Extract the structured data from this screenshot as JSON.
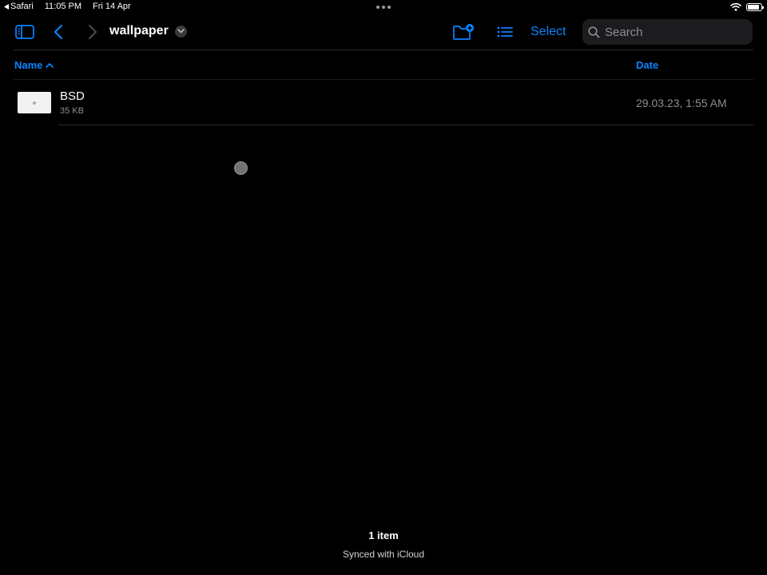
{
  "status_bar": {
    "back_app": "Safari",
    "time": "11:05 PM",
    "date": "Fri 14 Apr",
    "battery_level": 0.85
  },
  "toolbar": {
    "folder_title": "wallpaper",
    "select_label": "Select",
    "search_placeholder": "Search"
  },
  "columns": {
    "name_label": "Name",
    "date_label": "Date",
    "sort": "name-ascending"
  },
  "files": [
    {
      "name": "BSD",
      "size": "35 KB",
      "date": "29.03.23, 1:55 AM"
    }
  ],
  "footer": {
    "item_count": "1 item",
    "sync_status": "Synced with iCloud"
  },
  "colors": {
    "accent": "#0a84ff",
    "background": "#000000",
    "secondary_text": "#8e8e93"
  },
  "icons": {
    "sidebar": "sidebar-icon",
    "back": "chevron-left-icon",
    "forward": "chevron-right-icon",
    "title_menu": "chevron-down-icon",
    "new_folder": "folder-plus-icon",
    "view_options": "list-icon",
    "search": "search-icon",
    "sort": "chevron-up-icon",
    "wifi": "wifi-icon",
    "battery": "battery-icon"
  }
}
